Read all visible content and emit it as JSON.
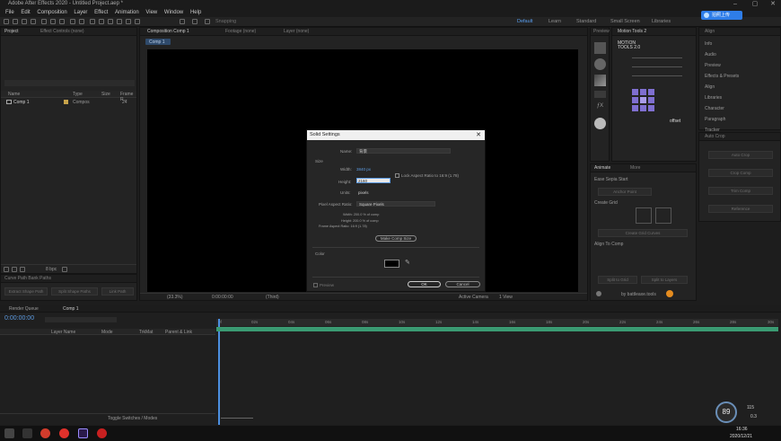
{
  "window": {
    "title": "Adobe After Effects 2020 - Untitled Project.aep *"
  },
  "menu": [
    "File",
    "Edit",
    "Composition",
    "Layer",
    "Effect",
    "Animation",
    "View",
    "Window",
    "Help"
  ],
  "toolbar": {
    "snapping_label": "Snapping"
  },
  "workspaces": [
    {
      "label": "Default",
      "active": true
    },
    {
      "label": "Learn",
      "active": false
    },
    {
      "label": "Standard",
      "active": false
    },
    {
      "label": "Small Screen",
      "active": false
    },
    {
      "label": "Libraries",
      "active": false
    }
  ],
  "badge_label": "拍照上传",
  "project_panel": {
    "tab_project": "Project",
    "tab_effect_controls": "Effect Controls (none)",
    "columns": {
      "name": "Name",
      "type": "Type",
      "size": "Size",
      "frame_rate": "Frame R..."
    },
    "items": [
      {
        "name": "Comp 1",
        "type": "Compos",
        "frame_rate": "24"
      }
    ],
    "bpc": "8 bpc"
  },
  "composition_panel": {
    "tab_comp": "Composition Comp 1",
    "tab_footage": "Footage (none)",
    "tab_layer": "Layer (none)",
    "breadcrumb": "Comp 1",
    "zoom": "(33.3%)",
    "time": "0:00:00:00",
    "resolution": "(Third)",
    "view": "Active Camera",
    "views_count": "1 View"
  },
  "lower_left_panel": {
    "title": "Curve Path Bank Paths",
    "buttons": [
      "Extract Shape Path",
      "Split Shape Paths",
      "Link Path"
    ]
  },
  "right_panels": {
    "tab_info": "Preview",
    "tab_motion": "Motion Tools 2",
    "motion_header": "MOTION",
    "motion_sub": "TOOLS 2.0",
    "offset_label": "offset",
    "tab_align": "Align",
    "align_items": [
      "Info",
      "Audio",
      "Preview",
      "Effects & Presets",
      "Align",
      "Libraries",
      "Character",
      "Paragraph",
      "Tracker"
    ],
    "tab_auto": "Auto Crop",
    "auto_buttons": [
      "Auto Crop",
      "Crop Comp",
      "Trim Comp",
      "Reference"
    ],
    "tab_animate": "Animate",
    "tab_more": "More",
    "ease_label": "Ease Sepia Start",
    "anchor_label": "Anchor Point",
    "create_grid_label": "Create Grid",
    "lower_buttons": [
      "Create Grid Curves"
    ],
    "align_to": "Align To Comp",
    "bottom_buttons": [
      "Split to Grid",
      "Split to Layers"
    ],
    "footer_text": "by battleaxe.tools"
  },
  "dialog": {
    "title": "Solid Settings",
    "name_label": "Name:",
    "name_value": "背景",
    "size_label": "Size",
    "width_label": "Width:",
    "width_value": "3840 px",
    "height_label": "Height:",
    "height_value": "2160",
    "lock_label": "Lock Aspect Ratio to 16:9 (1.78)",
    "units_label": "Units:",
    "units_value": "pixels",
    "par_label": "Pixel Aspect Ratio:",
    "par_value": "Square Pixels",
    "info_width": "Width: 200.0 % of comp",
    "info_height": "Height: 200.0 % of comp",
    "info_frame": "Frame Aspect Ratio: 16:9 (1.78)",
    "make_comp_size": "Make Comp Size",
    "color_label": "Color",
    "preview_label": "Preview",
    "ok": "OK",
    "cancel": "Cancel"
  },
  "timeline": {
    "tab_render": "Render Queue",
    "tab_comp": "Comp 1",
    "time": "0:00:00:00",
    "col_source": "Layer Name",
    "col_mode": "Mode",
    "col_trkmat": "TrkMat",
    "col_parent": "Parent & Link",
    "ticks": [
      "0f",
      "02s",
      "04s",
      "06s",
      "08s",
      "10s",
      "12s",
      "14s",
      "16s",
      "18s",
      "20s",
      "22s",
      "24s",
      "26s",
      "28s",
      "30s"
    ],
    "toggle_label": "Toggle Switches / Modes"
  },
  "system": {
    "gauge_value": "89",
    "net_up": "115",
    "net_down": "0.3",
    "clock_time": "16:36",
    "clock_date": "2020/12/21"
  }
}
